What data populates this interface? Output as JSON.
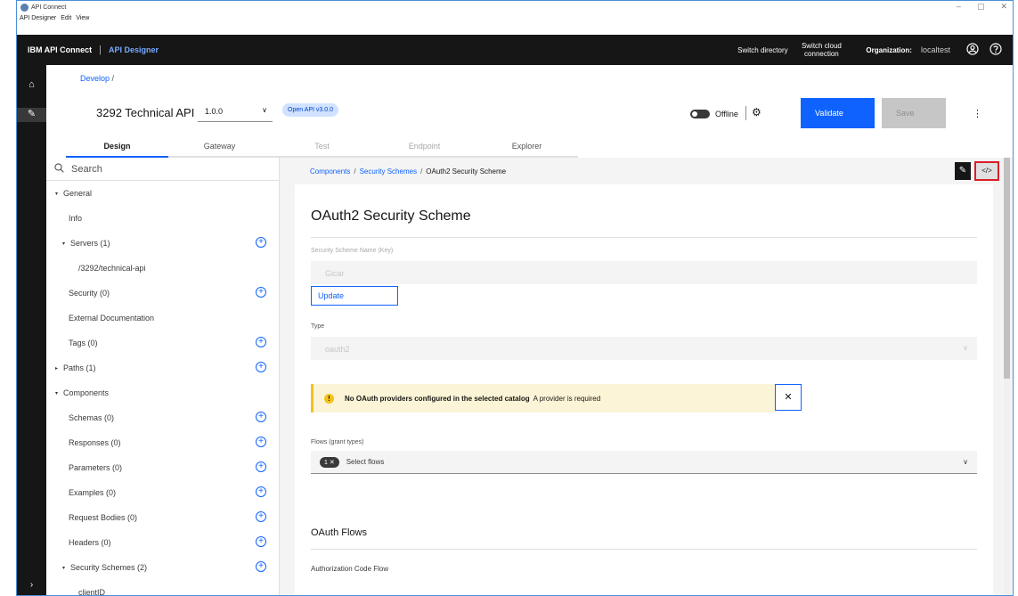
{
  "window": {
    "title": "API Connect",
    "menu": [
      "API Designer",
      "Edit",
      "View"
    ],
    "controls": [
      "–",
      "▢",
      "✕"
    ]
  },
  "topbar": {
    "brand": "IBM API Connect",
    "product": "API Designer",
    "switch_directory": "Switch directory",
    "switch_cloud": "Switch cloud connection",
    "org_label": "Organization:",
    "org_value": "localtest"
  },
  "breadcrumb_top": {
    "link": "Develop",
    "sep": "/"
  },
  "api": {
    "title": "3292 Technical API",
    "version": "1.0.0",
    "openapi_tag": "Open API v3.0.0",
    "offline_label": "Offline",
    "validate_label": "Validate",
    "save_label": "Save"
  },
  "tabs": [
    {
      "label": "Design",
      "state": "active"
    },
    {
      "label": "Gateway",
      "state": "normal"
    },
    {
      "label": "Test",
      "state": "disabled"
    },
    {
      "label": "Endpoint",
      "state": "disabled"
    },
    {
      "label": "Explorer",
      "state": "normal"
    }
  ],
  "sidebar": {
    "search_placeholder": "Search",
    "items": [
      {
        "label": "General",
        "indent": 0,
        "caret": "▾",
        "plus": false
      },
      {
        "label": "Info",
        "indent": 1,
        "caret": "",
        "plus": false
      },
      {
        "label": "Servers (1)",
        "indent": 1,
        "caret": "▾",
        "plus": true
      },
      {
        "label": "/3292/technical-api",
        "indent": 2,
        "caret": "",
        "plus": false
      },
      {
        "label": "Security (0)",
        "indent": 1,
        "caret": "",
        "plus": true
      },
      {
        "label": "External Documentation",
        "indent": 1,
        "caret": "",
        "plus": false
      },
      {
        "label": "Tags (0)",
        "indent": 1,
        "caret": "",
        "plus": true
      },
      {
        "label": "Paths (1)",
        "indent": 0,
        "caret": "▸",
        "plus": true
      },
      {
        "label": "Components",
        "indent": 0,
        "caret": "▾",
        "plus": false
      },
      {
        "label": "Schemas (0)",
        "indent": 1,
        "caret": "",
        "plus": true
      },
      {
        "label": "Responses (0)",
        "indent": 1,
        "caret": "",
        "plus": true
      },
      {
        "label": "Parameters (0)",
        "indent": 1,
        "caret": "",
        "plus": true
      },
      {
        "label": "Examples (0)",
        "indent": 1,
        "caret": "",
        "plus": true
      },
      {
        "label": "Request Bodies (0)",
        "indent": 1,
        "caret": "",
        "plus": true
      },
      {
        "label": "Headers (0)",
        "indent": 1,
        "caret": "",
        "plus": true
      },
      {
        "label": "Security Schemes (2)",
        "indent": 1,
        "caret": "▾",
        "plus": true
      },
      {
        "label": "clientID",
        "indent": 2,
        "caret": "",
        "plus": false
      }
    ]
  },
  "content": {
    "breadcrumb": [
      "Components",
      "Security Schemes",
      "OAuth2 Security Scheme"
    ],
    "title": "OAuth2 Security Scheme",
    "name_label": "Security Scheme Name (Key)",
    "name_value": "Gicar",
    "update_label": "Update",
    "type_label": "Type",
    "type_value": "oauth2",
    "warning_title": "No OAuth providers configured in the selected catalog",
    "warning_msg": "A provider is required",
    "flows_label": "Flows (grant types)",
    "flows_count": "1",
    "flows_placeholder": "Select flows",
    "oauth_flows_title": "OAuth Flows",
    "auth_code_label": "Authorization Code Flow"
  },
  "colors": {
    "accent": "#0f62fe",
    "topbar": "#161616",
    "warning": "#f1c21b",
    "highlight": "#da1e28"
  }
}
